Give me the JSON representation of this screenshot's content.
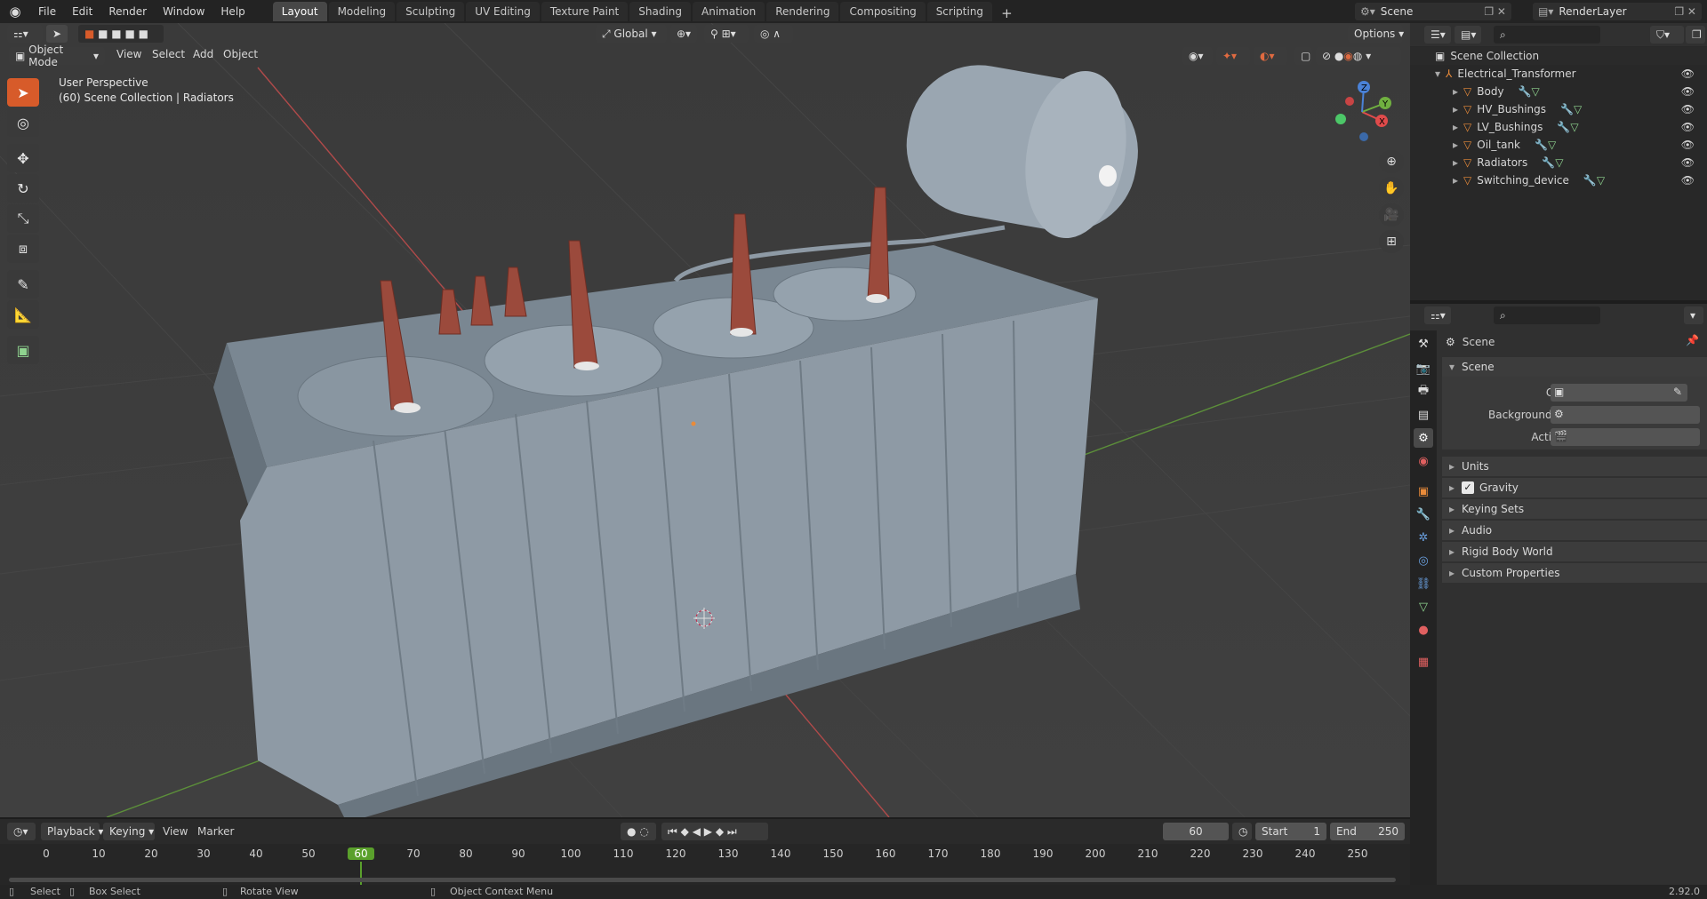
{
  "menubar": {
    "items": [
      "File",
      "Edit",
      "Render",
      "Window",
      "Help"
    ],
    "workspaces": [
      "Layout",
      "Modeling",
      "Sculpting",
      "UV Editing",
      "Texture Paint",
      "Shading",
      "Animation",
      "Rendering",
      "Compositing",
      "Scripting"
    ],
    "active_workspace": "Layout",
    "add_tab": "+",
    "scene_name": "Scene",
    "view_layer": "RenderLayer"
  },
  "viewport": {
    "transform_orientation": "Global",
    "options_label": "Options",
    "mode": "Object Mode",
    "menus": [
      "View",
      "Select",
      "Add",
      "Object"
    ],
    "perspective_label": "User Perspective",
    "collection_info": "(60) Scene Collection | Radiators",
    "gizmo_axes": [
      "X",
      "Y",
      "Z"
    ]
  },
  "outliner": {
    "root": "Scene Collection",
    "collection": "Electrical_Transformer",
    "objects": [
      "Body",
      "HV_Bushings",
      "LV_Bushings",
      "Oil_tank",
      "Radiators",
      "Switching_device"
    ]
  },
  "properties": {
    "context": "Scene",
    "panel_title": "Scene",
    "fields": [
      {
        "label": "Camera"
      },
      {
        "label": "Background Scene"
      },
      {
        "label": "Active Clip"
      }
    ],
    "subpanels": [
      "Units",
      "Gravity",
      "Keying Sets",
      "Audio",
      "Rigid Body World",
      "Custom Properties"
    ],
    "gravity_checked": true
  },
  "timeline": {
    "menus": [
      "Playback",
      "Keying",
      "View",
      "Marker"
    ],
    "current_frame": "60",
    "start_label": "Start",
    "start": "1",
    "end_label": "End",
    "end": "250",
    "ruler": [
      "0",
      "10",
      "20",
      "30",
      "40",
      "50",
      "60",
      "70",
      "80",
      "90",
      "100",
      "110",
      "120",
      "130",
      "140",
      "150",
      "160",
      "170",
      "180",
      "190",
      "200",
      "210",
      "220",
      "230",
      "240",
      "250"
    ]
  },
  "statusbar": {
    "hints": [
      "Select",
      "Box Select",
      "Rotate View",
      "Object Context Menu"
    ],
    "version": "2.92.0"
  },
  "colors": {
    "accent": "#d75b2a",
    "frame_green": "#5aa02c",
    "object_orange": "#e98b3a"
  }
}
